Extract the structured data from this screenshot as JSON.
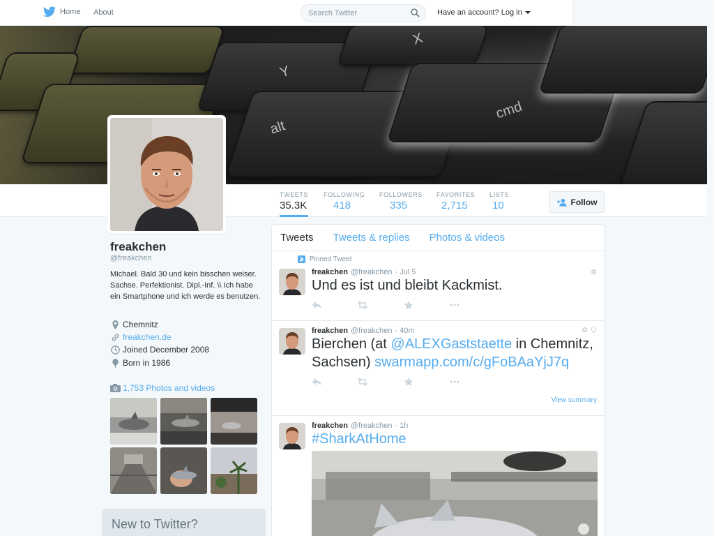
{
  "topnav": {
    "home_label": "Home",
    "about_label": "About",
    "search_placeholder": "Search Twitter",
    "login_label": "Have an account? Log in"
  },
  "stats": [
    {
      "label": "TWEETS",
      "value": "35.3K"
    },
    {
      "label": "FOLLOWING",
      "value": "418"
    },
    {
      "label": "FOLLOWERS",
      "value": "335"
    },
    {
      "label": "FAVORITES",
      "value": "2,715"
    },
    {
      "label": "LISTS",
      "value": "10"
    }
  ],
  "follow_label": "Follow",
  "header_keys": {
    "alt": "alt",
    "cmd": "cmd",
    "y": "Y",
    "x": "X"
  },
  "profile": {
    "name": "freakchen",
    "handle": "@freakchen",
    "bio": "Michael. Bald 30 und kein bisschen weiser. Sachse. Perfektionist. Dipl.-Inf. \\\\ Ich habe ein Smartphone und ich werde es benutzen.",
    "location": "Chemnitz",
    "website": "freakchen.de",
    "joined": "Joined December 2008",
    "born": "Born in 1986",
    "photos_link": "1,753 Photos and videos"
  },
  "new_to_twitter": "New to Twitter?",
  "timeline": {
    "tabs": [
      "Tweets",
      "Tweets & replies",
      "Photos & videos"
    ],
    "tweets": [
      {
        "pinned": "Pinned Tweet",
        "name": "freakchen",
        "handle": "@freakchen",
        "time": "· Jul 5",
        "text": "Und es ist und bleibt Kackmist."
      },
      {
        "name": "freakchen",
        "handle": "@freakchen",
        "time": "· 40m",
        "text_1": "Bierchen (at ",
        "mention": "@ALEXGaststaette",
        "text_2": " in Chemnitz, Sachsen) ",
        "link": "swarmapp.com/c/gFoBAaYjJ7q",
        "view_summary": "View summary"
      },
      {
        "name": "freakchen",
        "handle": "@freakchen",
        "time": "· 1h",
        "hashtag": "#SharkAtHome"
      }
    ]
  },
  "colors": {
    "accent": "#55acee",
    "text": "#292f33",
    "muted": "#8899a6",
    "border": "#e1e8ed",
    "background": "#f5f8fa"
  },
  "icons": [
    "twitter-bird-icon",
    "search-icon",
    "caret-down-icon",
    "follow-plus-icon",
    "location-pin-icon",
    "link-icon",
    "clock-icon",
    "balloon-icon",
    "camera-icon",
    "reply-icon",
    "retweet-icon",
    "favorite-star-icon",
    "more-dots-icon",
    "pin-icon",
    "geo-icon"
  ]
}
